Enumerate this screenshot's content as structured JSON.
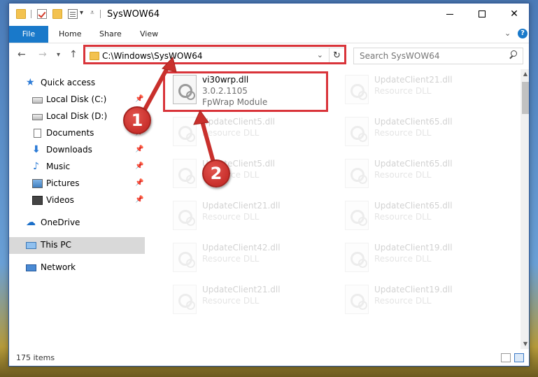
{
  "window": {
    "title": "SysWOW64"
  },
  "ribbon": {
    "tabs": [
      "File",
      "Home",
      "Share",
      "View"
    ],
    "expand_icon": "chevron-down-icon",
    "help_icon": "help-icon"
  },
  "address_bar": {
    "path": "C:\\Windows\\SysWOW64"
  },
  "search": {
    "placeholder": "Search SysWOW64"
  },
  "sidebar": {
    "items": [
      {
        "label": "Quick access",
        "icon": "star-icon",
        "pinned": false
      },
      {
        "label": "Local Disk (C:)",
        "icon": "disk-icon",
        "pinned": true
      },
      {
        "label": "Local Disk (D:)",
        "icon": "disk-icon",
        "pinned": false
      },
      {
        "label": "Documents",
        "icon": "documents-icon",
        "pinned": true
      },
      {
        "label": "Downloads",
        "icon": "downloads-icon",
        "pinned": true
      },
      {
        "label": "Music",
        "icon": "music-icon",
        "pinned": true
      },
      {
        "label": "Pictures",
        "icon": "pictures-icon",
        "pinned": true
      },
      {
        "label": "Videos",
        "icon": "videos-icon",
        "pinned": true
      },
      {
        "label": "OneDrive",
        "icon": "onedrive-icon",
        "pinned": false
      },
      {
        "label": "This PC",
        "icon": "this-pc-icon",
        "pinned": false,
        "selected": true
      },
      {
        "label": "Network",
        "icon": "network-icon",
        "pinned": false
      }
    ]
  },
  "files": {
    "highlighted": {
      "name": "vi30wrp.dll",
      "version": "3.0.2.1105",
      "type": "FpWrap Module"
    },
    "left_column": [
      {
        "name": "UpdateClient5.dll",
        "type": "Resource DLL"
      },
      {
        "name": "UpdateClient5.dll",
        "type": "Resource DLL"
      },
      {
        "name": "UpdateClient21.dll",
        "type": "Resource DLL"
      },
      {
        "name": "UpdateClient42.dll",
        "type": "Resource DLL"
      },
      {
        "name": "UpdateClient21.dll",
        "type": "Resource DLL"
      }
    ],
    "right_column": [
      {
        "name": "UpdateClient21.dll",
        "type": "Resource DLL"
      },
      {
        "name": "UpdateClient65.dll",
        "type": "Resource DLL"
      },
      {
        "name": "UpdateClient65.dll",
        "type": "Resource DLL"
      },
      {
        "name": "UpdateClient65.dll",
        "type": "Resource DLL"
      },
      {
        "name": "UpdateClient19.dll",
        "type": "Resource DLL"
      },
      {
        "name": "UpdateClient19.dll",
        "type": "Resource DLL"
      }
    ]
  },
  "status": {
    "item_count": "175 items"
  },
  "callouts": [
    "1",
    "2"
  ],
  "colors": {
    "accent": "#1979ca",
    "highlight_box": "#d9343a",
    "selected_nav": "#d9d9d9"
  }
}
